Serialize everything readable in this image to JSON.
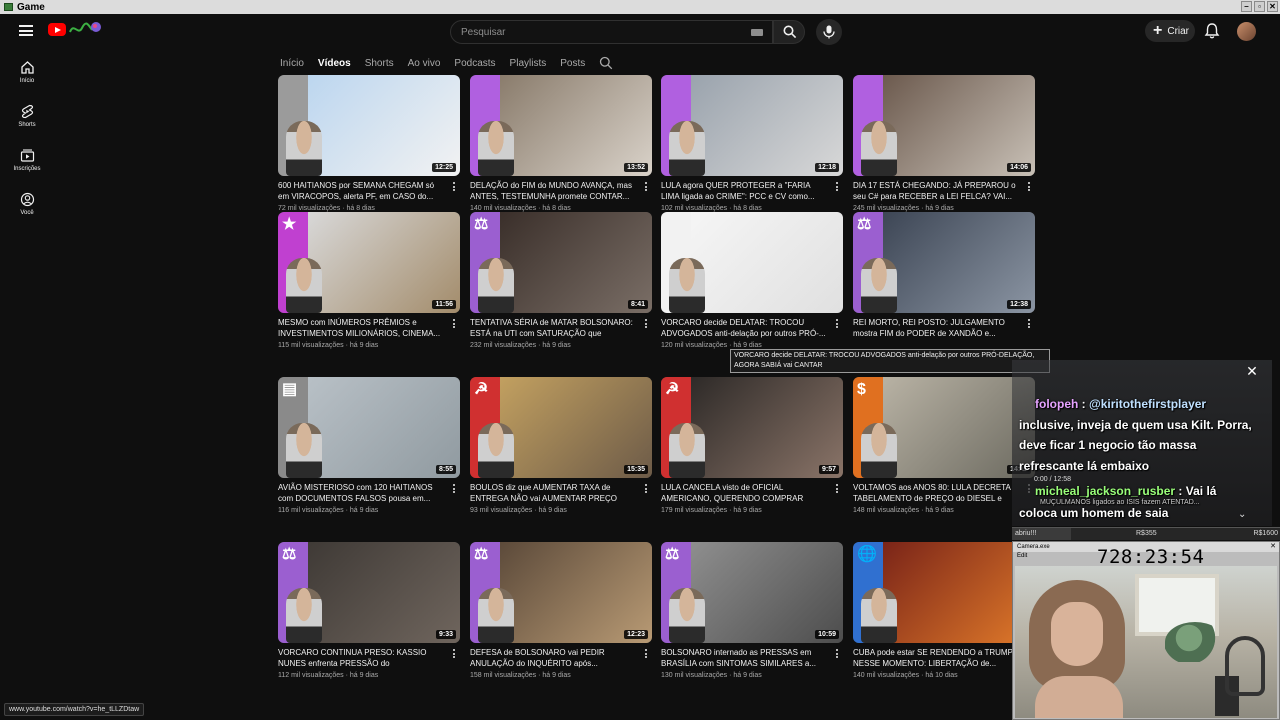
{
  "window": {
    "title": "Game",
    "controls": [
      "–",
      "▫",
      "✕"
    ]
  },
  "header": {
    "search_placeholder": "Pesquisar",
    "create_label": "Criar"
  },
  "rail": [
    {
      "label": "Início",
      "icon": "home-icon"
    },
    {
      "label": "Shorts",
      "icon": "shorts-icon"
    },
    {
      "label": "Inscrições",
      "icon": "subscriptions-icon"
    },
    {
      "label": "Você",
      "icon": "you-icon"
    }
  ],
  "tabs": [
    "Início",
    "Vídeos",
    "Shorts",
    "Ao vivo",
    "Podcasts",
    "Playlists",
    "Posts"
  ],
  "active_tab": "Vídeos",
  "videos": [
    {
      "title": "600 HAITIANOS por SEMANA CHEGAM só em VIRACOPOS, alerta PF, em CASO do...",
      "views": "72 mil visualizações",
      "age": "há 8 dias",
      "duration": "12:25",
      "stripe": "#9b9b9b",
      "symbol": ""
    },
    {
      "title": "DELAÇÃO do FIM do MUNDO AVANÇA, mas ANTES, TESTEMUNHA promete CONTAR...",
      "views": "140 mil visualizações",
      "age": "há 8 dias",
      "duration": "13:52",
      "stripe": "#b060e0",
      "symbol": ""
    },
    {
      "title": "LULA agora QUER PROTEGER a \"FARIA LIMA ligada ao CRIME\": PCC e CV como...",
      "views": "102 mil visualizações",
      "age": "há 8 dias",
      "duration": "12:18",
      "stripe": "#b060e0",
      "symbol": ""
    },
    {
      "title": "DIA 17 ESTÁ CHEGANDO: JÁ PREPAROU o seu C# para RECEBER a LEI FELCA? VAI...",
      "views": "245 mil visualizações",
      "age": "há 9 dias",
      "duration": "14:06",
      "stripe": "#b060e0",
      "symbol": ""
    },
    {
      "title": "MESMO com INÚMEROS PRÊMIOS e INVESTIMENTOS MILIONÁRIOS, CINEMA...",
      "views": "115 mil visualizações",
      "age": "há 9 dias",
      "duration": "11:56",
      "stripe": "#c040d0",
      "symbol": "★"
    },
    {
      "title": "TENTATIVA SÉRIA de MATAR BOLSONARO: ESTÁ na UTI com SATURAÇÃO que CHEGO...",
      "views": "232 mil visualizações",
      "age": "há 9 dias",
      "duration": "8:41",
      "stripe": "#9b5fd0",
      "symbol": "⚖"
    },
    {
      "title": "VORCARO decide DELATAR: TROCOU ADVOGADOS anti-delação por outros PRÓ-...",
      "views": "120 mil visualizações",
      "age": "há 9 dias",
      "duration": "",
      "stripe": "#f2f2f2",
      "symbol": ""
    },
    {
      "title": "REI MORTO, REI POSTO: JULGAMENTO mostra FIM do PODER de XANDÃO e...",
      "views": "",
      "age": "",
      "duration": "12:38",
      "stripe": "#9b5fd0",
      "symbol": "⚖"
    },
    {
      "title": "AVIÃO MISTERIOSO com 120 HAITIANOS com DOCUMENTOS FALSOS pousa em...",
      "views": "116 mil visualizações",
      "age": "há 9 dias",
      "duration": "8:55",
      "stripe": "#8a8a8a",
      "symbol": "▤"
    },
    {
      "title": "BOULOS diz que AUMENTAR TAXA de ENTREGA NÃO vai AUMENTAR PREÇO par...",
      "views": "93 mil visualizações",
      "age": "há 9 dias",
      "duration": "15:35",
      "stripe": "#d03030",
      "symbol": "☭"
    },
    {
      "title": "LULA CANCELA visto de OFICIAL AMERICANO, QUERENDO COMPRAR BRIG...",
      "views": "179 mil visualizações",
      "age": "há 9 dias",
      "duration": "9:57",
      "stripe": "#d03030",
      "symbol": "☭"
    },
    {
      "title": "VOLTAMOS aos ANOS 80: LULA DECRETA TABELAMENTO de PREÇO do DIESEL e RS...",
      "views": "148 mil visualizações",
      "age": "há 9 dias",
      "duration": "14:12",
      "stripe": "#e07020",
      "symbol": "$"
    },
    {
      "title": "VORCARO CONTINUA PRESO: KASSIO NUNES enfrenta PRESSÃO do CONGRESSO...",
      "views": "112 mil visualizações",
      "age": "há 9 dias",
      "duration": "9:33",
      "stripe": "#9b5fd0",
      "symbol": "⚖"
    },
    {
      "title": "DEFESA de BOLSONARO vai PEDIR ANULAÇÃO do INQUÉRITO após...",
      "views": "158 mil visualizações",
      "age": "há 9 dias",
      "duration": "12:23",
      "stripe": "#9b5fd0",
      "symbol": "⚖"
    },
    {
      "title": "BOLSONARO internado as PRESSAS em BRASÍLIA com SINTOMAS SIMILARES a...",
      "views": "130 mil visualizações",
      "age": "há 9 dias",
      "duration": "10:59",
      "stripe": "#9b5fd0",
      "symbol": "⚖"
    },
    {
      "title": "CUBA pode estar SE RENDENDO a TRUMP NESSE MOMENTO: LIBERTAÇÃO de...",
      "views": "140 mil visualizações",
      "age": "há 10 dias",
      "duration": "",
      "stripe": "#3070d0",
      "symbol": "🌐"
    }
  ],
  "tooltip": "VORCARO decide DELATAR: TROCOU ADVOGADOS anti-delação por outros PRÓ-DELAÇÃO, AGORA SABIÁ vai CANTAR",
  "status_url": "www.youtube.com/watch?v=he_tLLZDtaw",
  "chat": {
    "line1_user": "folopeh",
    "line1_sep": ":",
    "line1_mention": "@kiritothefirstplayer",
    "line2": "inclusive, inveja de quem usa Kilt. Porra,",
    "line3": "deve ficar 1 negocio tão massa",
    "line4": "refrescante lá embaixo",
    "line5_user": "micheal_jackson_rusber",
    "line5_sep": ":",
    "line5_msg": "Vai lá",
    "line6": "coloca um homem de saia",
    "time": "0:00 / 12:58",
    "under": "MUÇULMANOS ligados ao ISIS fazem ATENTAD..."
  },
  "donate": {
    "left": "abriu!!!",
    "mid": "R$355",
    "right": "R$1600",
    "progress": 0.22
  },
  "camera": {
    "title": "Camera.exe",
    "menu": "Edit",
    "clock": "728:23:54"
  }
}
